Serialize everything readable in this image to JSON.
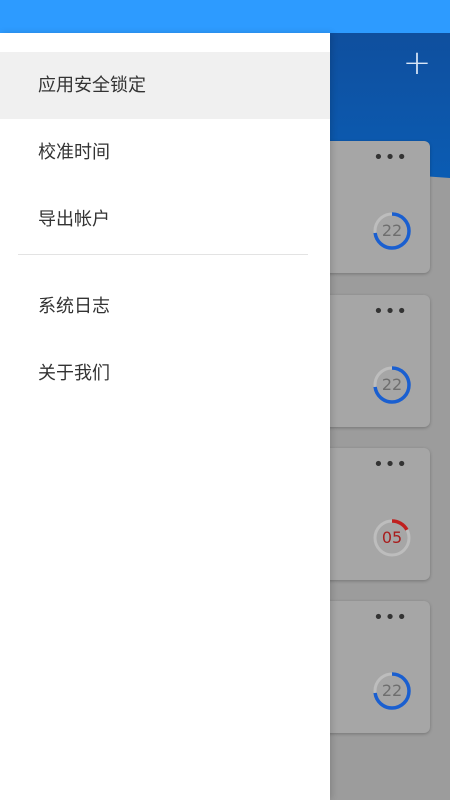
{
  "colors": {
    "status_bar": "#2d9bff",
    "header": "#0b5cb3",
    "ring_blue": "#1a5fd0",
    "ring_red": "#c0201f"
  },
  "header": {
    "add_icon": "plus-icon"
  },
  "cards": [
    {
      "more": "•••",
      "countdown": "22",
      "progress": 0.73,
      "state": "normal"
    },
    {
      "more": "•••",
      "countdown": "22",
      "progress": 0.73,
      "state": "normal"
    },
    {
      "more": "•••",
      "countdown": "05",
      "progress": 0.17,
      "state": "warning"
    },
    {
      "more": "•••",
      "countdown": "22",
      "progress": 0.73,
      "state": "normal"
    }
  ],
  "drawer": {
    "items": [
      {
        "label": "应用安全锁定",
        "active": true
      },
      {
        "label": "校准时间"
      },
      {
        "label": "导出帐户"
      },
      {
        "label": "系统日志"
      },
      {
        "label": "关于我们"
      }
    ]
  }
}
